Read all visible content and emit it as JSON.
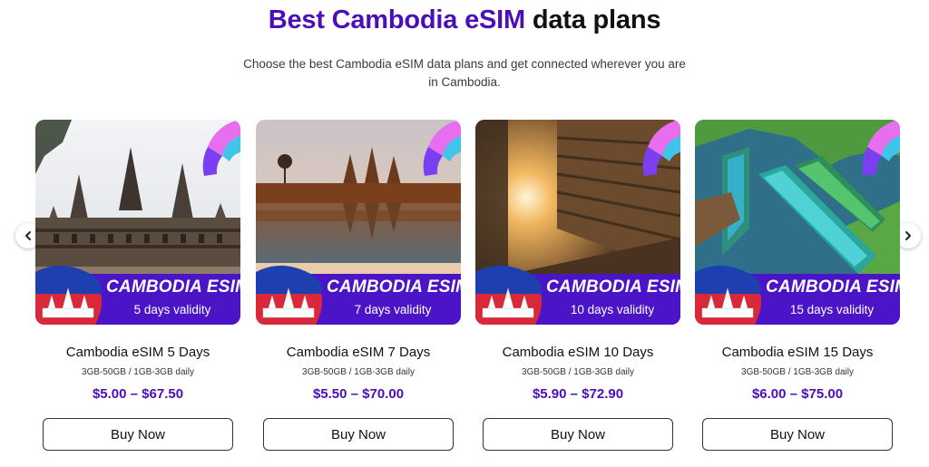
{
  "header": {
    "title_accent": "Best Cambodia eSIM",
    "title_rest": "data plans",
    "subtitle": "Choose the best Cambodia eSIM data plans and get connected wherever you are in Cambodia.",
    "accent_color": "#4a0fb8"
  },
  "carousel": {
    "prev_icon": "chevron-left-icon",
    "next_icon": "chevron-right-icon"
  },
  "plans": [
    {
      "banner_title": "CAMBODIA ESIM",
      "banner_validity": "5 days validity",
      "title": "Cambodia eSIM 5 Days",
      "data": "3GB-50GB / 1GB-3GB daily",
      "price": "$5.00 – $67.50",
      "button": "Buy Now"
    },
    {
      "banner_title": "CAMBODIA ESIM",
      "banner_validity": "7 days validity",
      "title": "Cambodia eSIM 7 Days",
      "data": "3GB-50GB / 1GB-3GB daily",
      "price": "$5.50 – $70.00",
      "button": "Buy Now"
    },
    {
      "banner_title": "CAMBODIA ESIM",
      "banner_validity": "10 days validity",
      "title": "Cambodia eSIM 10 Days",
      "data": "3GB-50GB / 1GB-3GB daily",
      "price": "$5.90 – $72.90",
      "button": "Buy Now"
    },
    {
      "banner_title": "CAMBODIA ESIM",
      "banner_validity": "15 days validity",
      "title": "Cambodia eSIM 15 Days",
      "data": "3GB-50GB / 1GB-3GB daily",
      "price": "$6.00 – $75.00",
      "button": "Buy Now"
    }
  ]
}
